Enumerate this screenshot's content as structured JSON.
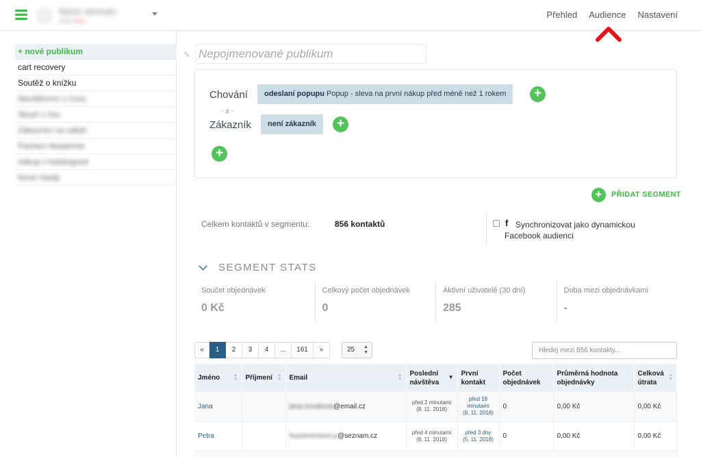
{
  "header": {
    "account_name": "Název obchodu",
    "account_sub": "účet",
    "account_sub_badge": "free",
    "nav": [
      "Přehled",
      "Audience",
      "Nastavení"
    ]
  },
  "sidebar": {
    "items": [
      {
        "label": "+ nové publikum",
        "blurred": false
      },
      {
        "label": "cart recovery",
        "blurred": false
      },
      {
        "label": "Soutěž o knížku",
        "blurred": false
      },
      {
        "label": "Návštěvníci z čsou",
        "blurred": true
      },
      {
        "label": "Skrytí z čsu",
        "blurred": true
      },
      {
        "label": "Zákaznici na odběr",
        "blurred": true
      },
      {
        "label": "Partneri Akademie",
        "blurred": true
      },
      {
        "label": "nákup v katalogové",
        "blurred": true
      },
      {
        "label": "Nové ťáady",
        "blurred": true
      }
    ]
  },
  "main": {
    "title_placeholder": "Nepojmenované publikum",
    "segment": {
      "behavior_label": "Chování",
      "behavior_chip_bold": "odeslaní popupu",
      "behavior_chip_text": " Popup - sleva na první nákup před méně než 1 rokem",
      "or_label": "- a -",
      "customer_label": "Zákazník",
      "customer_chip": "není zákazník"
    },
    "add_segment_label": "PŘIDAT SEGMENT",
    "contacts_label": "Celkem kontaktů v segmentu:",
    "contacts_value": "856 kontaktů",
    "facebook_sync_line1": "Synchronizovat jako dynamickou",
    "facebook_sync_line2": "Facebook audienci",
    "stats_title": "SEGMENT STATS",
    "stats": [
      {
        "label": "Součet objednávek",
        "value": "0 Kč"
      },
      {
        "label": "Celkový počet objednávek",
        "value": "0"
      },
      {
        "label": "Aktivní uživatelé (30 dní)",
        "value": "285"
      },
      {
        "label": "Doba mezi objednávkami",
        "value": "-"
      }
    ],
    "pager": [
      "«",
      "1",
      "2",
      "3",
      "4",
      "...",
      "161",
      "»"
    ],
    "pager_active": "1",
    "per_page": "25",
    "search_placeholder": "Hledej mezi 856 kontakty...",
    "table": {
      "headers": [
        "Jméno",
        "Příjmení",
        "Email",
        "Poslední návštěva",
        "První kontakt",
        "Počet objednávek",
        "Průměrná hodnota objednávky",
        "Celková útrata"
      ],
      "rows": [
        {
          "jmeno": "Jana",
          "prijmeni": "",
          "email_hidden": "jana.novakova",
          "email_domain": "@email.cz",
          "posledni": "před 2 minutami",
          "posledni_date": "(8. 11. 2018)",
          "prvni": "před 18 minutami",
          "prvni_date": "(8. 11. 2018)",
          "pocet": "0",
          "prumer": "0,00 Kč",
          "celkem": "0,00 Kč"
        },
        {
          "jmeno": "Petra",
          "prijmeni": "",
          "email_hidden": "huuzimeniooo.p",
          "email_domain": "@seznam.cz",
          "posledni": "před 4 minutami",
          "posledni_date": "(8. 11. 2018)",
          "prvni": "před 3 dny",
          "prvni_date": "(5. 11. 2018)",
          "pocet": "0",
          "prumer": "0,00 Kč",
          "celkem": "0,00 Kč"
        }
      ]
    }
  },
  "colors": {
    "accent_green": "#43b94b",
    "primary_blue": "#2b5e86",
    "annotation_red": "#e8141b"
  }
}
